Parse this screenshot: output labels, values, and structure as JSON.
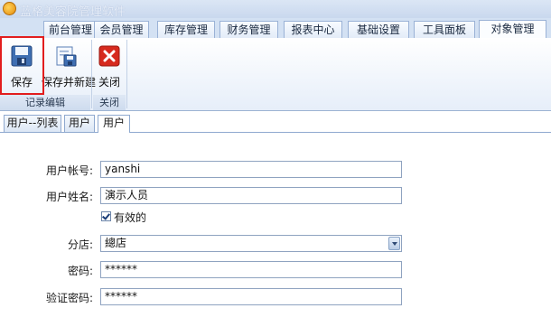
{
  "app": {
    "title": "蓝格美容院管理软件"
  },
  "menu": {
    "tabs": [
      {
        "label": "前台管理"
      },
      {
        "label": "会员管理"
      },
      {
        "label": "库存管理"
      },
      {
        "label": "财务管理"
      },
      {
        "label": "报表中心"
      },
      {
        "label": "基础设置"
      },
      {
        "label": "工具面板"
      },
      {
        "label": "对象管理"
      }
    ],
    "active": "对象管理"
  },
  "ribbon": {
    "groups": [
      {
        "label": "记录编辑",
        "buttons": [
          {
            "label": "保存",
            "icon": "save-icon"
          },
          {
            "label": "保存并新建",
            "icon": "save-new-icon"
          }
        ]
      },
      {
        "label": "关闭",
        "buttons": [
          {
            "label": "关闭",
            "icon": "close-icon"
          }
        ]
      }
    ]
  },
  "subtabs": [
    {
      "label": "用户--列表"
    },
    {
      "label": "用户"
    },
    {
      "label": "用户"
    }
  ],
  "form": {
    "account_label": "用户帐号:",
    "account_value": "yanshi",
    "name_label": "用户姓名:",
    "name_value": "演示人员",
    "valid_label": "有效的",
    "valid_checked": true,
    "store_label": "分店:",
    "store_value": "總店",
    "password_label": "密码:",
    "password_value": "******",
    "confirm_label": "验证密码:",
    "confirm_value": "******"
  },
  "colors": {
    "highlight": "#e21d1d",
    "ribbon_border": "#9db3d3",
    "close_icon": "#d62a1e"
  }
}
